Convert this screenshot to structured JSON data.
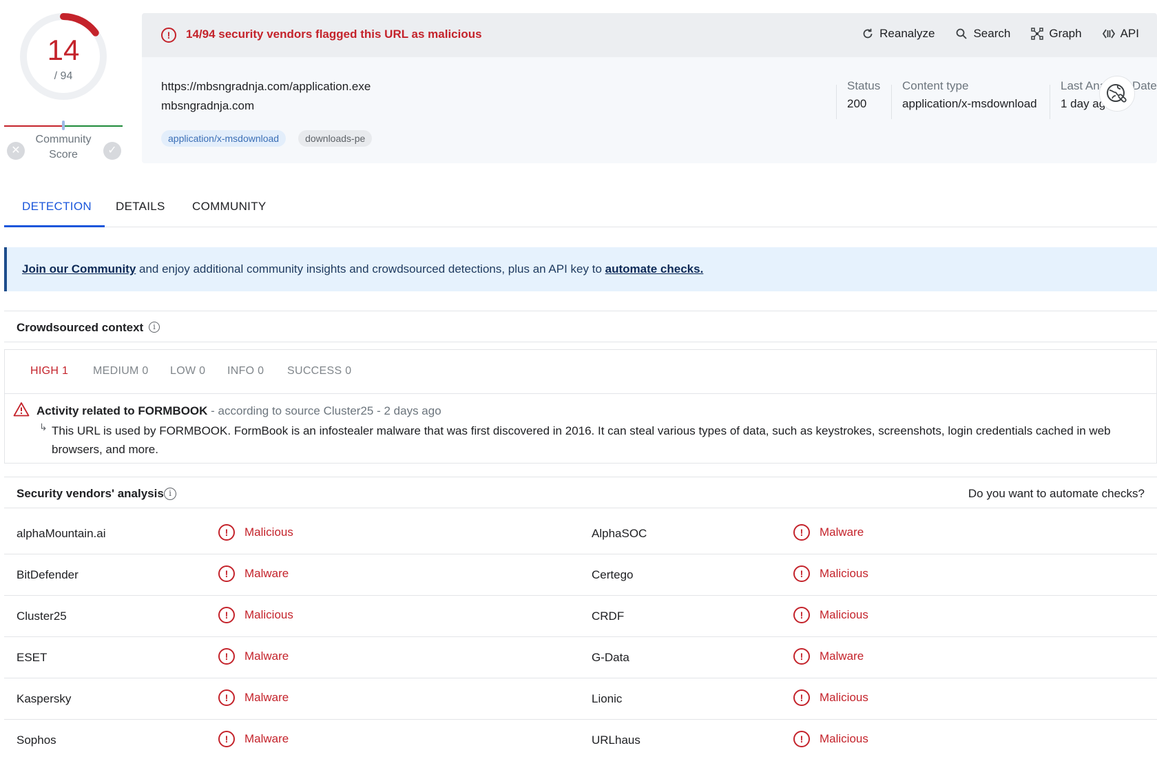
{
  "score": {
    "detections": "14",
    "total": "/ 94",
    "community_label_line1": "Community",
    "community_label_line2": "Score",
    "ring_fraction": 0.149
  },
  "alert": {
    "text": "14/94 security vendors flagged this URL as malicious"
  },
  "actions": [
    {
      "label": "Reanalyze",
      "icon": "refresh-icon"
    },
    {
      "label": "Search",
      "icon": "search-icon"
    },
    {
      "label": "Graph",
      "icon": "graph-icon"
    },
    {
      "label": "API",
      "icon": "api-icon"
    }
  ],
  "url": {
    "full": "https://mbsngradnja.com/application.exe",
    "domain": "mbsngradnja.com",
    "tags": [
      "application/x-msdownload",
      "downloads-pe"
    ]
  },
  "meta": {
    "status_label": "Status",
    "status_value": "200",
    "content_type_label": "Content type",
    "content_type_value": "application/x-msdownload",
    "last_analysis_label": "Last Analysis Date",
    "last_analysis_value": "1 day ago"
  },
  "tabs": [
    "DETECTION",
    "DETAILS",
    "COMMUNITY"
  ],
  "banner": {
    "link1": "Join our Community",
    "middle": " and enjoy additional community insights and crowdsourced detections, plus an API key to ",
    "link2": "automate checks."
  },
  "crowdsourced": {
    "title": "Crowdsourced context",
    "filters": [
      "HIGH 1",
      "MEDIUM 0",
      "LOW 0",
      "INFO 0",
      "SUCCESS 0"
    ],
    "item_title": "Activity related to FORMBOOK",
    "item_source": " - according to source Cluster25 - 2 days ago",
    "item_desc": "This URL is used by FORMBOOK. FormBook is an infostealer malware that was first discovered in 2016. It can steal various types of data, such as keystrokes, screenshots, login credentials cached in web browsers, and more."
  },
  "vendors_section": {
    "title": "Security vendors' analysis",
    "automate": "Do you want to automate checks?"
  },
  "vendors": [
    {
      "left_name": "alphaMountain.ai",
      "left_result": "Malicious",
      "right_name": "AlphaSOC",
      "right_result": "Malware"
    },
    {
      "left_name": "BitDefender",
      "left_result": "Malware",
      "right_name": "Certego",
      "right_result": "Malicious"
    },
    {
      "left_name": "Cluster25",
      "left_result": "Malicious",
      "right_name": "CRDF",
      "right_result": "Malicious"
    },
    {
      "left_name": "ESET",
      "left_result": "Malware",
      "right_name": "G-Data",
      "right_result": "Malware"
    },
    {
      "left_name": "Kaspersky",
      "left_result": "Malware",
      "right_name": "Lionic",
      "right_result": "Malicious"
    },
    {
      "left_name": "Sophos",
      "left_result": "Malware",
      "right_name": "URLhaus",
      "right_result": "Malicious"
    }
  ],
  "colors": {
    "malicious_red": "#c4232b",
    "accent_blue": "#1a56db"
  }
}
